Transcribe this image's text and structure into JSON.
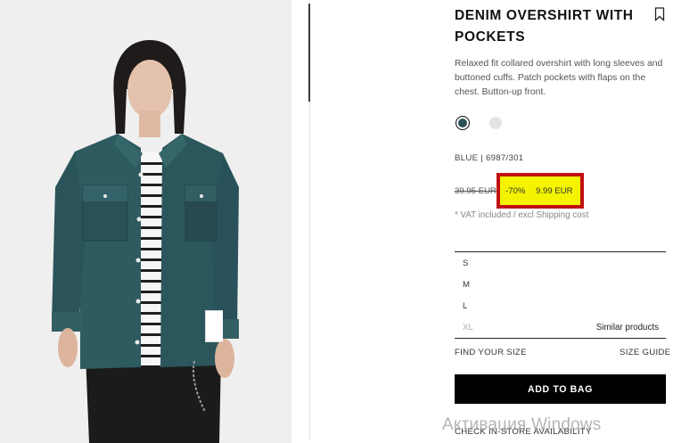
{
  "product": {
    "title": "DENIM OVERSHIRT WITH POCKETS",
    "description": "Relaxed fit collared overshirt with long sleeves and buttoned cuffs. Patch pockets with flaps on the chest. Button-up front.",
    "color_ref": "BLUE | 6987/301",
    "colors": [
      {
        "name": "blue",
        "hex": "#2c4f58",
        "selected": true
      },
      {
        "name": "light-grey",
        "hex": "#e4e4e4",
        "selected": false
      }
    ]
  },
  "price": {
    "old": "39.95 EUR",
    "discount": "-70%",
    "current": "9.99 EUR",
    "vat_note": "* VAT included / excl Shipping cost",
    "highlight_fill": "#f4f400",
    "highlight_border": "#c21010"
  },
  "sizes": {
    "options": [
      "S",
      "M",
      "L",
      "XL"
    ],
    "unavailable": [
      "XL"
    ],
    "similar_label": "Similar products"
  },
  "links": {
    "find_size": "FIND YOUR SIZE",
    "size_guide": "SIZE GUIDE",
    "store_availability": "CHECK IN-STORE AVAILABILITY"
  },
  "actions": {
    "add_to_bag": "ADD TO BAG"
  },
  "icons": {
    "bookmark": "bookmark-icon"
  },
  "watermark": "Активация Windows"
}
